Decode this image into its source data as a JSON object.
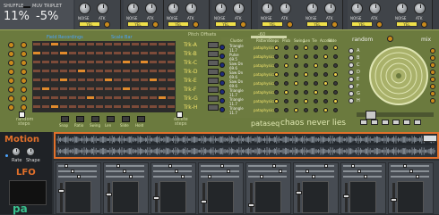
{
  "top": {
    "labels": [
      "SHUFFLE",
      "MUV TRIPLET"
    ],
    "shuffle_value": "11%",
    "triplet_value": "-5%",
    "module_labels": [
      "NOISE",
      "ATK"
    ],
    "yel": "YEL"
  },
  "seq": {
    "title1": "Field Recordings",
    "title2": "Scale Bar",
    "tracks": [
      "Trk-A",
      "Trk-B",
      "Trk-C",
      "Trk-D",
      "Trk-E",
      "Trk-F",
      "Trk-G",
      "Trk-H"
    ],
    "button_labels": [
      "Snap",
      "Ratio",
      "Swing",
      "Len",
      "Slide",
      "Hold"
    ],
    "bottom_left": "random",
    "bottom_left2": "steps",
    "bottom_right": "delete",
    "bottom_right2": "steps"
  },
  "pataseq": {
    "header": "Pitch Offsets",
    "header_value": "-60",
    "cols": [
      "Cluster",
      "Pattern",
      "Steps",
      "Prob",
      "Swing",
      "Len",
      "Tie",
      "Accent",
      "Slide"
    ],
    "rows": [
      {
        "name": "Triangle",
        "val": "11.7",
        "pattern": "pataphysical"
      },
      {
        "name": "Pulse",
        "val": "69.5",
        "pattern": "pataphysical"
      },
      {
        "name": "Saw Dn",
        "val": "69.6",
        "pattern": "pataphysical"
      },
      {
        "name": "Saw Dn",
        "val": "69.6",
        "pattern": "pataphysical"
      },
      {
        "name": "Saw Dn",
        "val": "69.6",
        "pattern": "pataphysical"
      },
      {
        "name": "Triangle",
        "val": "11.7",
        "pattern": "pataphysical"
      },
      {
        "name": "Triangle",
        "val": "11.7",
        "pattern": "pataphysical"
      },
      {
        "name": "Triangle",
        "val": "11.7",
        "pattern": "pataphysical"
      }
    ],
    "brand": "pataseq",
    "tagline": "chaos never lies"
  },
  "random": {
    "title": "random",
    "mix": "mix",
    "letters": [
      "A",
      "B",
      "C",
      "D",
      "E",
      "F",
      "G",
      "H"
    ]
  },
  "motion": {
    "title": "Motion",
    "lfo": "LFO",
    "knob1": "Rate",
    "knob2": "Shape",
    "brand": "pa"
  },
  "colors": {
    "accent": "#e2702a",
    "olive": "#6b7a3e",
    "lamp": "#c98a1c",
    "led": "#f0d24a",
    "cell_on": "#e08a2c"
  }
}
